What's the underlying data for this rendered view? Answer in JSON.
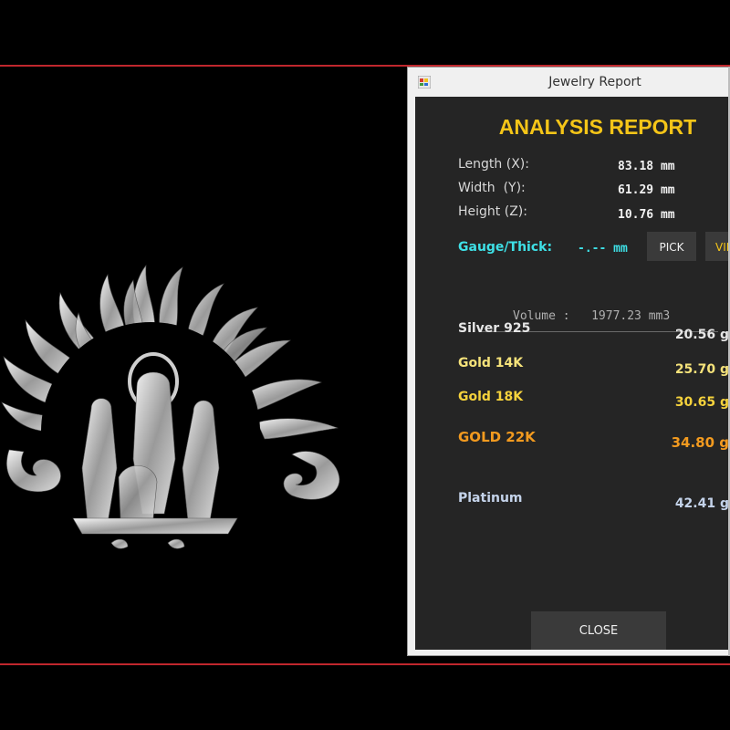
{
  "window": {
    "title": "Jewelry Report"
  },
  "report": {
    "heading": "ANALYSIS REPORT",
    "dimensions": [
      {
        "label": "Length (X):",
        "value": "83.18 mm"
      },
      {
        "label": "Width  (Y):",
        "value": "61.29 mm"
      },
      {
        "label": "Height (Z):",
        "value": "10.76 mm"
      }
    ],
    "gauge": {
      "label": "Gauge/Thick:",
      "value": "-.-- mm",
      "pick_label": "PICK",
      "view_label": "VIE"
    },
    "volume": "Volume :   1977.23 mm3",
    "metals": [
      {
        "label": "Silver 925",
        "value": "20.56 g",
        "color": "#e6e6e6"
      },
      {
        "label": "Gold 14K",
        "value": "25.70 g",
        "color": "#f5e27a"
      },
      {
        "label": "Gold 18K",
        "value": "30.65 g",
        "color": "#f5d23c"
      },
      {
        "label": "GOLD 22K",
        "value": "34.80 g",
        "color": "#f29a1f"
      },
      {
        "label": "Platinum",
        "value": "42.41 g",
        "color": "#c4d3ea"
      }
    ],
    "close_label": "CLOSE"
  },
  "colors": {
    "accent_border": "#c0272d",
    "heading": "#f5c518",
    "gauge": "#3ee0e6",
    "panel_bg": "#252525"
  },
  "icons": {
    "app": "app-window-icon",
    "model": "jewelry-pendant-model"
  }
}
